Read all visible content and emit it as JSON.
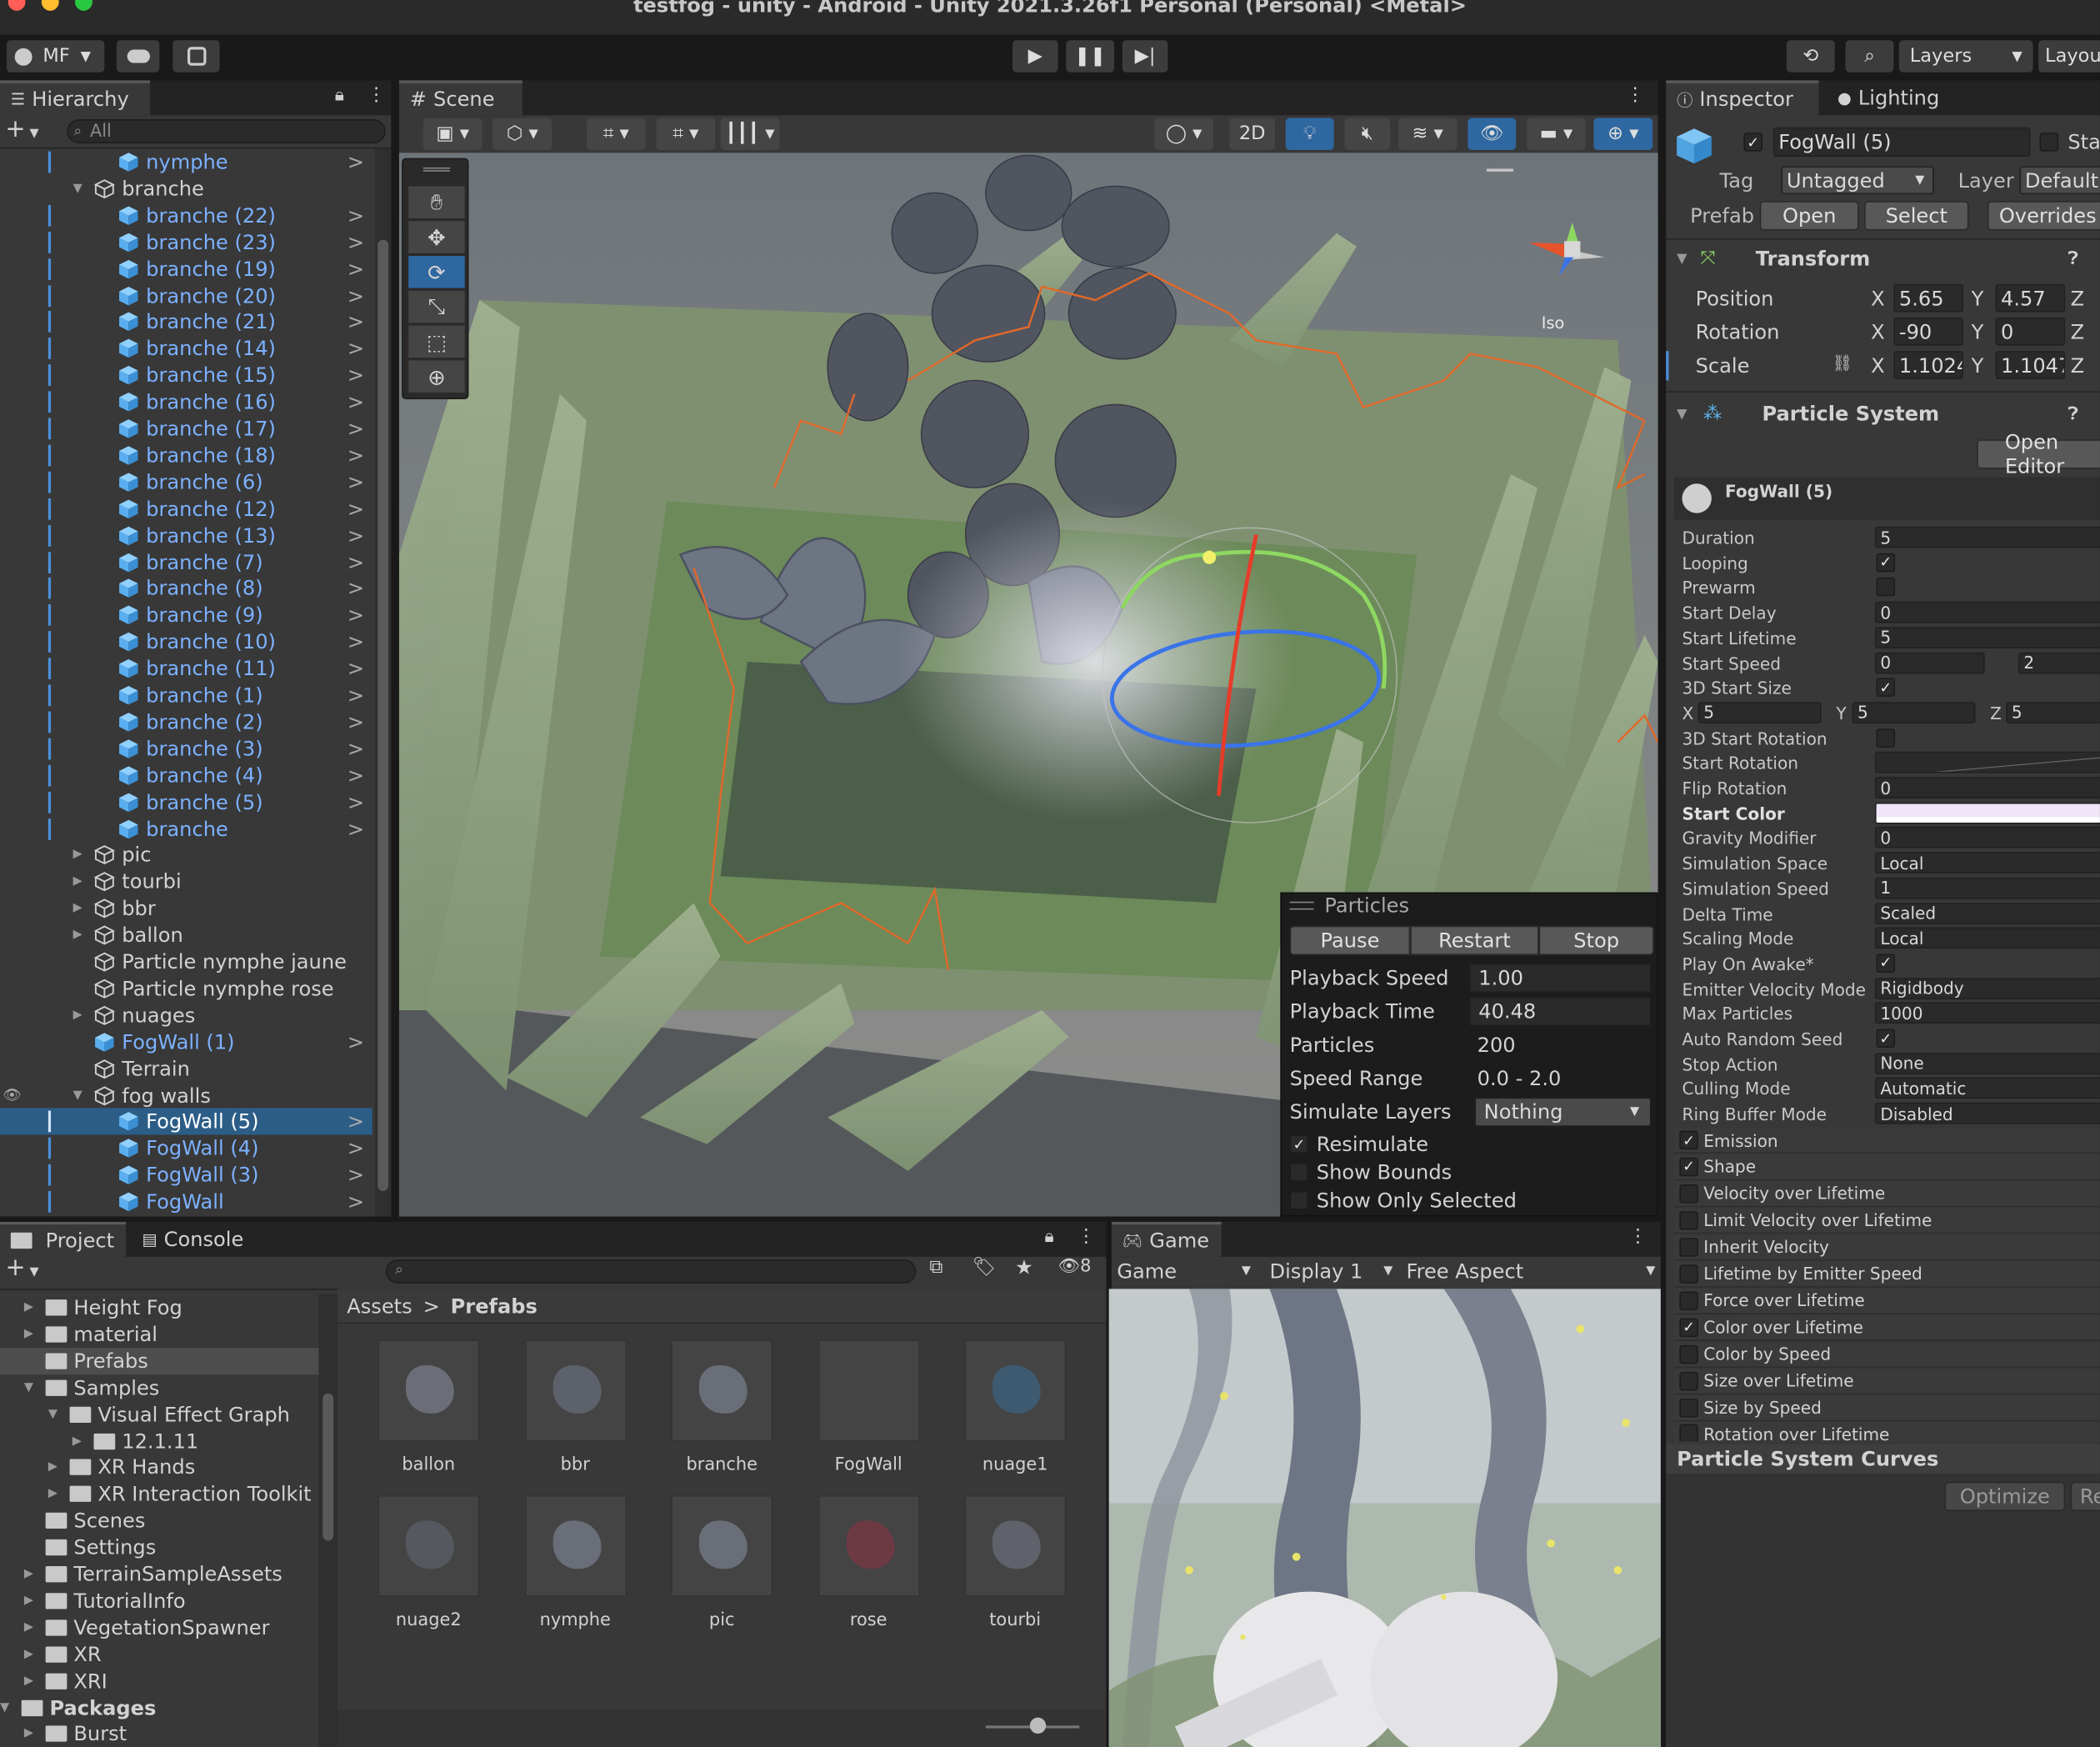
{
  "window": {
    "title": "testfog - unity - Android - Unity 2021.3.26f1 Personal (Personal) <Metal>"
  },
  "toolbar": {
    "account": "MF",
    "layers": "Layers",
    "layout": "Layou"
  },
  "hierarchy": {
    "tab": "Hierarchy",
    "search_placeholder": "All",
    "items": [
      {
        "label": "nymphe",
        "indent": 1,
        "prefab": true,
        "arrow": true
      },
      {
        "label": "branche",
        "indent": 0,
        "prefab": false,
        "expanded": true
      },
      {
        "label": "branche (22)",
        "indent": 1,
        "prefab": true,
        "arrow": true
      },
      {
        "label": "branche (23)",
        "indent": 1,
        "prefab": true,
        "arrow": true
      },
      {
        "label": "branche (19)",
        "indent": 1,
        "prefab": true,
        "arrow": true
      },
      {
        "label": "branche (20)",
        "indent": 1,
        "prefab": true,
        "arrow": true
      },
      {
        "label": "branche (21)",
        "indent": 1,
        "prefab": true,
        "arrow": true
      },
      {
        "label": "branche (14)",
        "indent": 1,
        "prefab": true,
        "arrow": true
      },
      {
        "label": "branche (15)",
        "indent": 1,
        "prefab": true,
        "arrow": true
      },
      {
        "label": "branche (16)",
        "indent": 1,
        "prefab": true,
        "arrow": true
      },
      {
        "label": "branche (17)",
        "indent": 1,
        "prefab": true,
        "arrow": true
      },
      {
        "label": "branche (18)",
        "indent": 1,
        "prefab": true,
        "arrow": true
      },
      {
        "label": "branche (6)",
        "indent": 1,
        "prefab": true,
        "arrow": true
      },
      {
        "label": "branche (12)",
        "indent": 1,
        "prefab": true,
        "arrow": true
      },
      {
        "label": "branche (13)",
        "indent": 1,
        "prefab": true,
        "arrow": true
      },
      {
        "label": "branche (7)",
        "indent": 1,
        "prefab": true,
        "arrow": true
      },
      {
        "label": "branche (8)",
        "indent": 1,
        "prefab": true,
        "arrow": true
      },
      {
        "label": "branche (9)",
        "indent": 1,
        "prefab": true,
        "arrow": true
      },
      {
        "label": "branche (10)",
        "indent": 1,
        "prefab": true,
        "arrow": true
      },
      {
        "label": "branche (11)",
        "indent": 1,
        "prefab": true,
        "arrow": true
      },
      {
        "label": "branche (1)",
        "indent": 1,
        "prefab": true,
        "arrow": true
      },
      {
        "label": "branche (2)",
        "indent": 1,
        "prefab": true,
        "arrow": true
      },
      {
        "label": "branche (3)",
        "indent": 1,
        "prefab": true,
        "arrow": true
      },
      {
        "label": "branche (4)",
        "indent": 1,
        "prefab": true,
        "arrow": true
      },
      {
        "label": "branche (5)",
        "indent": 1,
        "prefab": true,
        "arrow": true
      },
      {
        "label": "branche",
        "indent": 1,
        "prefab": true,
        "arrow": true
      },
      {
        "label": "pic",
        "indent": 0,
        "prefab": false,
        "collapsed": true
      },
      {
        "label": "tourbi",
        "indent": 0,
        "prefab": false,
        "collapsed": true
      },
      {
        "label": "bbr",
        "indent": 0,
        "prefab": false,
        "collapsed": true
      },
      {
        "label": "ballon",
        "indent": 0,
        "prefab": false,
        "collapsed": true
      },
      {
        "label": "Particle nymphe jaune",
        "indent": 0,
        "prefab": false
      },
      {
        "label": "Particle nymphe rose",
        "indent": 0,
        "prefab": false
      },
      {
        "label": "nuages",
        "indent": 0,
        "prefab": false,
        "collapsed": true
      },
      {
        "label": "FogWall (1)",
        "indent": 0,
        "prefab": true,
        "arrow": true
      },
      {
        "label": "Terrain",
        "indent": 0,
        "prefab": false
      },
      {
        "label": "fog walls",
        "indent": 0,
        "prefab": false,
        "expanded": true
      },
      {
        "label": "FogWall (5)",
        "indent": 1,
        "prefab": true,
        "arrow": true,
        "selected": true
      },
      {
        "label": "FogWall (4)",
        "indent": 1,
        "prefab": true,
        "arrow": true
      },
      {
        "label": "FogWall (3)",
        "indent": 1,
        "prefab": true,
        "arrow": true
      },
      {
        "label": "FogWall",
        "indent": 1,
        "prefab": true,
        "arrow": true
      }
    ]
  },
  "scene": {
    "tab": "Scene",
    "btn_2d": "2D",
    "iso": "Iso"
  },
  "particles_overlay": {
    "title": "Particles",
    "buttons": [
      "Pause",
      "Restart",
      "Stop"
    ],
    "fields": [
      {
        "label": "Playback Speed",
        "value": "1.00"
      },
      {
        "label": "Playback Time",
        "value": "40.48"
      },
      {
        "label": "Particles",
        "value": "200"
      },
      {
        "label": "Speed Range",
        "value": "0.0 - 2.0"
      }
    ],
    "simulate_label": "Simulate Layers",
    "simulate_value": "Nothing",
    "checks": [
      {
        "label": "Resimulate",
        "checked": true
      },
      {
        "label": "Show Bounds",
        "checked": false
      },
      {
        "label": "Show Only Selected",
        "checked": false
      }
    ]
  },
  "inspector": {
    "tab_inspector": "Inspector",
    "tab_lighting": "Lighting",
    "object_name": "FogWall (5)",
    "static_label": "Sta",
    "tag_label": "Tag",
    "tag_value": "Untagged",
    "layer_label": "Layer",
    "layer_value": "Default",
    "prefab_label": "Prefab",
    "prefab_open": "Open",
    "prefab_select": "Select",
    "prefab_overrides": "Overrides",
    "transform_title": "Transform",
    "position_label": "Position",
    "rotation_label": "Rotation",
    "scale_label": "Scale",
    "pos_x": "5.65",
    "pos_y": "4.57",
    "rot_x": "-90",
    "rot_y": "0",
    "scale_x": "1.1024",
    "scale_y": "1.1047",
    "axis_x": "X",
    "axis_y": "Y",
    "axis_z": "Z",
    "ps_title": "Particle System",
    "open_editor": "Open Editor",
    "ps_name": "FogWall (5)",
    "rows": [
      {
        "label": "Duration",
        "value": "5"
      },
      {
        "label": "Looping",
        "check": true
      },
      {
        "label": "Prewarm",
        "check": false
      },
      {
        "label": "Start Delay",
        "value": "0"
      },
      {
        "label": "Start Lifetime",
        "value": "5"
      },
      {
        "label": "Start Speed",
        "value": "0",
        "value2": "2"
      },
      {
        "label": "3D Start Size",
        "check": true
      },
      {
        "label": "",
        "xyz": [
          "5",
          "5",
          "5"
        ]
      },
      {
        "label": "3D Start Rotation",
        "check": false
      },
      {
        "label": "Start Rotation",
        "curve": true
      },
      {
        "label": "Flip Rotation",
        "value": "0"
      },
      {
        "label": "Start Color",
        "color": true,
        "bold": true
      },
      {
        "label": "Gravity Modifier",
        "value": "0"
      },
      {
        "label": "Simulation Space",
        "value": "Local"
      },
      {
        "label": "Simulation Speed",
        "value": "1"
      },
      {
        "label": "Delta Time",
        "value": "Scaled"
      },
      {
        "label": "Scaling Mode",
        "value": "Local"
      },
      {
        "label": "Play On Awake*",
        "check": true
      },
      {
        "label": "Emitter Velocity Mode",
        "value": "Rigidbody"
      },
      {
        "label": "Max Particles",
        "value": "1000"
      },
      {
        "label": "Auto Random Seed",
        "check": true
      },
      {
        "label": "Stop Action",
        "value": "None"
      },
      {
        "label": "Culling Mode",
        "value": "Automatic"
      },
      {
        "label": "Ring Buffer Mode",
        "value": "Disabled"
      }
    ],
    "modules": [
      {
        "label": "Emission",
        "checked": true
      },
      {
        "label": "Shape",
        "checked": true
      },
      {
        "label": "Velocity over Lifetime",
        "checked": false
      },
      {
        "label": "Limit Velocity over Lifetime",
        "checked": false
      },
      {
        "label": "Inherit Velocity",
        "checked": false
      },
      {
        "label": "Lifetime by Emitter Speed",
        "checked": false
      },
      {
        "label": "Force over Lifetime",
        "checked": false
      },
      {
        "label": "Color over Lifetime",
        "checked": true
      },
      {
        "label": "Color by Speed",
        "checked": false
      },
      {
        "label": "Size over Lifetime",
        "checked": false
      },
      {
        "label": "Size by Speed",
        "checked": false
      },
      {
        "label": "Rotation over Lifetime",
        "checked": false
      }
    ],
    "curves_title": "Particle System Curves",
    "optimize": "Optimize",
    "remove": "Re"
  },
  "project": {
    "tab_project": "Project",
    "tab_console": "Console",
    "hidden_count": "8",
    "breadcrumb_root": "Assets",
    "breadcrumb_current": "Prefabs",
    "tree": [
      {
        "label": "Height Fog",
        "indent": 1,
        "arrow": true
      },
      {
        "label": "material",
        "indent": 1,
        "arrow": true
      },
      {
        "label": "Prefabs",
        "indent": 1,
        "arrow": false,
        "selected": true
      },
      {
        "label": "Samples",
        "indent": 1,
        "arrow": true,
        "open": true
      },
      {
        "label": "Visual Effect Graph",
        "indent": 2,
        "arrow": true,
        "open": true
      },
      {
        "label": "12.1.11",
        "indent": 3,
        "arrow": true
      },
      {
        "label": "XR Hands",
        "indent": 2,
        "arrow": true
      },
      {
        "label": "XR Interaction Toolkit",
        "indent": 2,
        "arrow": true
      },
      {
        "label": "Scenes",
        "indent": 1,
        "arrow": false
      },
      {
        "label": "Settings",
        "indent": 1,
        "arrow": false
      },
      {
        "label": "TerrainSampleAssets",
        "indent": 1,
        "arrow": true
      },
      {
        "label": "TutorialInfo",
        "indent": 1,
        "arrow": true
      },
      {
        "label": "VegetationSpawner",
        "indent": 1,
        "arrow": true
      },
      {
        "label": "XR",
        "indent": 1,
        "arrow": true
      },
      {
        "label": "XRI",
        "indent": 1,
        "arrow": true
      },
      {
        "label": "Packages",
        "indent": 0,
        "arrow": true,
        "open": true,
        "bold": true
      },
      {
        "label": "Burst",
        "indent": 1,
        "arrow": true
      }
    ],
    "assets": [
      "ballon",
      "bbr",
      "branche",
      "FogWall",
      "nuage1",
      "nuage2",
      "nymphe",
      "pic",
      "rose",
      "tourbi"
    ]
  },
  "game": {
    "tab": "Game",
    "mode": "Game",
    "display": "Display 1",
    "aspect": "Free Aspect"
  }
}
